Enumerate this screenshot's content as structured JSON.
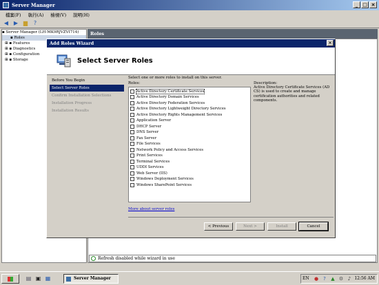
{
  "window": {
    "title": "Server Manager"
  },
  "menu": [
    "檔案(F)",
    "執行(A)",
    "檢視(V)",
    "說明(H)"
  ],
  "tree": {
    "root": "Server Manager (LH-MK9RJVZVI714)",
    "items": [
      "Roles",
      "Features",
      "Diagnostics",
      "Configuration",
      "Storage"
    ]
  },
  "content": {
    "band_title": "Roles",
    "refresh_status": "Refresh disabled while wizard in use"
  },
  "wizard": {
    "title": "Add Roles Wizard",
    "close_glyph": "×",
    "heading": "Select Server Roles",
    "steps": [
      {
        "label": "Before You Begin",
        "state": "normal"
      },
      {
        "label": "Select Server Roles",
        "state": "active"
      },
      {
        "label": "Confirm Installation Selections",
        "state": "disabled"
      },
      {
        "label": "Installation Progress",
        "state": "disabled"
      },
      {
        "label": "Installation Results",
        "state": "disabled"
      }
    ],
    "instruction": "Select one or more roles to install on this server.",
    "roles_label": "Roles:",
    "roles": [
      "Active Directory Certificate Services",
      "Active Directory Domain Services",
      "Active Directory Federation Services",
      "Active Directory Lightweight Directory Services",
      "Active Directory Rights Management Services",
      "Application Server",
      "DHCP Server",
      "DNS Server",
      "Fax Server",
      "File Services",
      "Network Policy and Access Services",
      "Print Services",
      "Terminal Services",
      "UDDI Services",
      "Web Server (IIS)",
      "Windows Deployment Services",
      "Windows SharePoint Services"
    ],
    "description_label": "Description:",
    "description": "Active Directory Certificate Services (AD CS) is used to create and manage certification authorities and related components.",
    "more_link": "More about server roles",
    "buttons": {
      "previous": "< Previous",
      "next": "Next >",
      "install": "Install",
      "cancel": "Cancel"
    }
  },
  "taskbar": {
    "start_label": "Start",
    "task_label": "Server Manager",
    "language": "EN",
    "clock": "12:56 AM"
  },
  "icons": {
    "back": "back-arrow-icon",
    "forward": "forward-arrow-icon",
    "folder": "folder-icon",
    "help": "help-icon"
  },
  "colors": {
    "title_bar": "#0a246a",
    "selection": "#0a246a",
    "link": "#0000cc",
    "band": "#5a6470"
  }
}
